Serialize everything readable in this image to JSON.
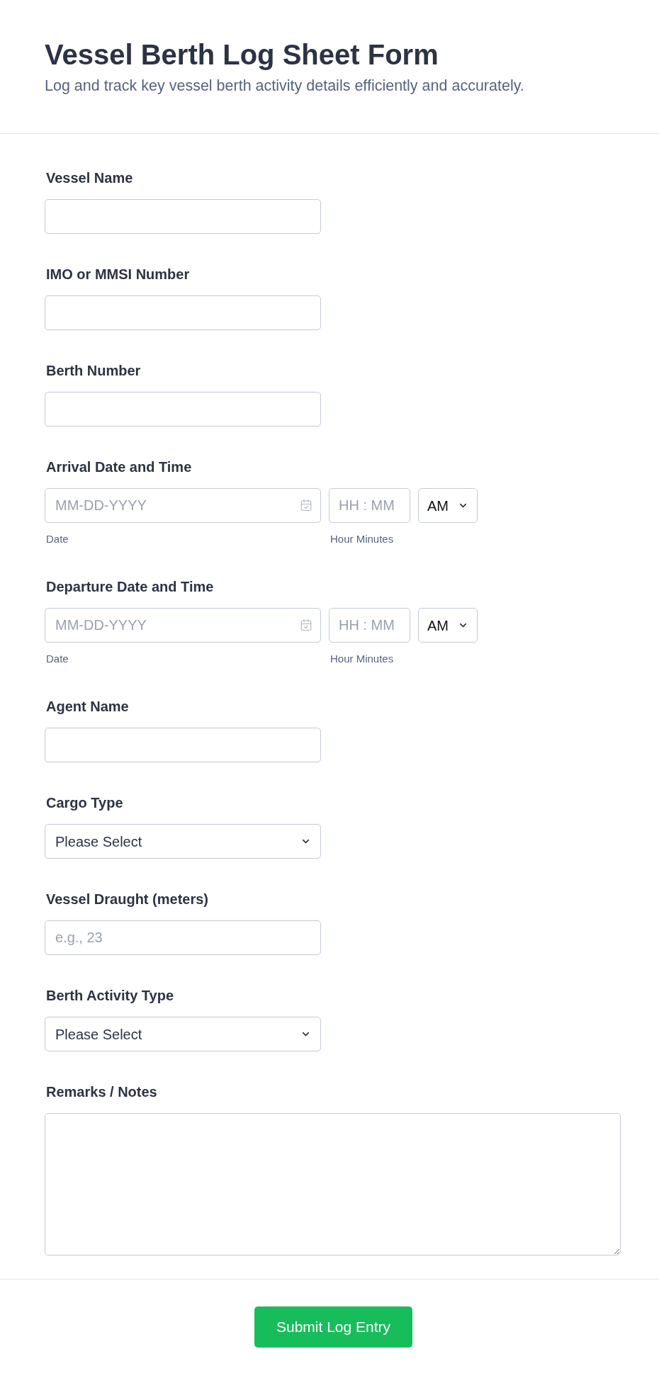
{
  "header": {
    "title": "Vessel Berth Log Sheet Form",
    "subtitle": "Log and track key vessel berth activity details efficiently and accurately."
  },
  "fields": [
    {
      "kind": "text",
      "label": "Vessel Name"
    },
    {
      "kind": "text",
      "label": "IMO or MMSI Number"
    },
    {
      "kind": "text",
      "label": "Berth Number"
    },
    {
      "kind": "datetime",
      "label": "Arrival Date and Time",
      "date": {
        "placeholder": "MM-DD-YYYY",
        "sublabel": "Date"
      },
      "time": {
        "placeholder": "HH : MM",
        "sublabel": "Hour Minutes"
      },
      "period": {
        "value": "AM"
      }
    },
    {
      "kind": "datetime",
      "label": "Departure Date and Time",
      "date": {
        "placeholder": "MM-DD-YYYY",
        "sublabel": "Date"
      },
      "time": {
        "placeholder": "HH : MM",
        "sublabel": "Hour Minutes"
      },
      "period": {
        "value": "AM"
      }
    },
    {
      "kind": "text",
      "label": "Agent Name"
    },
    {
      "kind": "select",
      "label": "Cargo Type",
      "value": "Please Select"
    },
    {
      "kind": "text",
      "label": "Vessel Draught (meters)",
      "placeholder": "e.g., 23"
    },
    {
      "kind": "select",
      "label": "Berth Activity Type",
      "value": "Please Select"
    },
    {
      "kind": "textarea",
      "label": "Remarks / Notes"
    }
  ],
  "submit_button": "Submit Log Entry"
}
